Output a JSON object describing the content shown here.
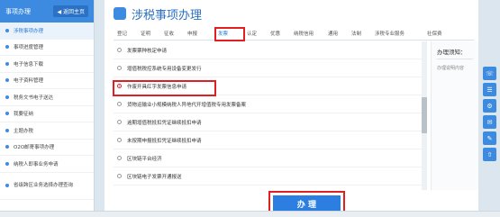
{
  "sidebar": {
    "title": "事项办理",
    "back_label": "◀ 返回主页",
    "items": [
      {
        "label": "涉税事项办理",
        "active": true
      },
      {
        "label": "事项进度管理"
      },
      {
        "label": "电子信息下载"
      },
      {
        "label": "电子资料管理"
      },
      {
        "label": "税务文书电子送达"
      },
      {
        "label": "我要征纳"
      },
      {
        "label": "主题办税"
      },
      {
        "label": "O2O邮寄事项办理"
      },
      {
        "label": "纳税人即事业务申请"
      },
      {
        "label": "省级跨区业务选择办理查询"
      }
    ]
  },
  "header": {
    "title": "涉税事项办理"
  },
  "tabs": [
    "登记",
    "证明",
    "征收",
    "申报",
    "发票",
    "认定",
    "优惠",
    "纳税信用",
    "通用",
    "法制",
    "涉税专业服务",
    "社保费"
  ],
  "list": [
    "发票票种核定申请",
    "增值税税控系统专用设备变更发行",
    "作废开具红字发票信息申请",
    "货物运输业小规模纳税人异地代开增值税专用发票备案",
    "逾期增值税抵扣凭证继续抵扣申请",
    "未按期申报抵扣凭证继续抵扣申请",
    "区块链平台经济",
    "区块链电子发票开通报送"
  ],
  "side_panel": {
    "title": "办理须知：",
    "text": "办理说明内容"
  },
  "submit_label": "办 理",
  "right_tools": [
    "☏",
    "☰",
    "⚙",
    "✉",
    "✎",
    "⇧"
  ]
}
